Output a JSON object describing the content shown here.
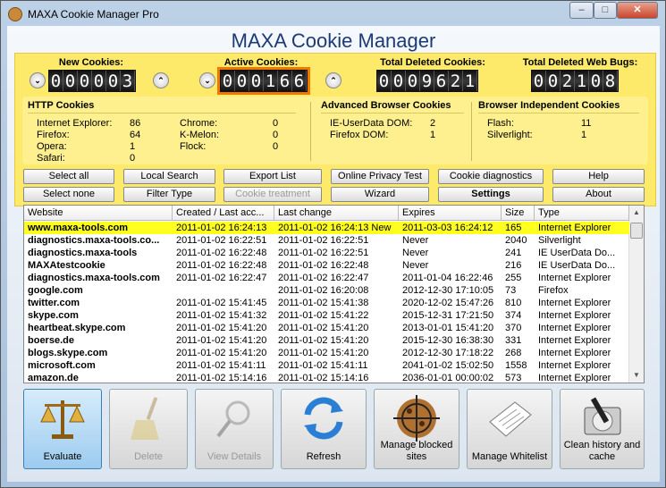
{
  "window": {
    "title": "MAXA Cookie Manager Pro",
    "minimize": "–",
    "maximize": "□",
    "close": "✕"
  },
  "brand": "MAXA Cookie Manager",
  "counters": [
    {
      "label": "New Cookies:",
      "digits": [
        "0",
        "0",
        "0",
        "0",
        "0",
        "3"
      ]
    },
    {
      "label": "Active Cookies:",
      "digits": [
        "0",
        "0",
        "0",
        "1",
        "6",
        "6"
      ]
    },
    {
      "label": "Total Deleted Cookies:",
      "digits": [
        "0",
        "0",
        "0",
        "9",
        "6",
        "2",
        "1"
      ]
    },
    {
      "label": "Total Deleted Web Bugs:",
      "digits": [
        "0",
        "0",
        "2",
        "1",
        "0",
        "8"
      ]
    }
  ],
  "arrows": {
    "down": "⌄",
    "up": "⌃"
  },
  "stats": {
    "http": {
      "title": "HTTP Cookies",
      "items": [
        [
          "Internet Explorer:",
          "86"
        ],
        [
          "Firefox:",
          "64"
        ],
        [
          "Opera:",
          "1"
        ],
        [
          "Safari:",
          "0"
        ],
        [
          "Chrome:",
          "0"
        ],
        [
          "K-Melon:",
          "0"
        ],
        [
          "Flock:",
          "0"
        ]
      ]
    },
    "advanced": {
      "title": "Advanced Browser Cookies",
      "items": [
        [
          "IE-UserData DOM:",
          "2"
        ],
        [
          "Firefox DOM:",
          "1"
        ]
      ]
    },
    "independent": {
      "title": "Browser Independent Cookies",
      "items": [
        [
          "Flash:",
          "11"
        ],
        [
          "Silverlight:",
          "1"
        ]
      ]
    }
  },
  "buttons": {
    "select_all": "Select all",
    "local_search": "Local Search",
    "export_list": "Export List",
    "privacy_test": "Online Privacy Test",
    "diagnostics": "Cookie diagnostics",
    "help": "Help",
    "select_none": "Select none",
    "filter_type": "Filter Type",
    "cookie_treatment": "Cookie treatment",
    "wizard": "Wizard",
    "settings": "Settings",
    "about": "About"
  },
  "table": {
    "columns": [
      "Website",
      "Created / Last acc...",
      "Last change",
      "Expires",
      "Size",
      "Type"
    ],
    "rows": [
      [
        "www.maxa-tools.com",
        "2011-01-02 16:24:13",
        "2011-01-02 16:24:13 New",
        "2011-03-03 16:24:12",
        "165",
        "Internet Explorer"
      ],
      [
        "diagnostics.maxa-tools.co...",
        "2011-01-02 16:22:51",
        "2011-01-02 16:22:51",
        "Never",
        "2040",
        "Silverlight"
      ],
      [
        "diagnostics.maxa-tools",
        "2011-01-02 16:22:48",
        "2011-01-02 16:22:51",
        "Never",
        "241",
        "IE UserData Do..."
      ],
      [
        "MAXAtestcookie",
        "2011-01-02 16:22:48",
        "2011-01-02 16:22:48",
        "Never",
        "216",
        "IE UserData Do..."
      ],
      [
        "diagnostics.maxa-tools.com",
        "2011-01-02 16:22:47",
        "2011-01-02 16:22:47",
        "2011-01-04 16:22:46",
        "255",
        "Internet Explorer"
      ],
      [
        "google.com",
        "",
        "2011-01-02 16:20:08",
        "2012-12-30 17:10:05",
        "73",
        "Firefox"
      ],
      [
        "twitter.com",
        "2011-01-02 15:41:45",
        "2011-01-02 15:41:38",
        "2020-12-02 15:47:26",
        "810",
        "Internet Explorer"
      ],
      [
        "skype.com",
        "2011-01-02 15:41:32",
        "2011-01-02 15:41:22",
        "2015-12-31 17:21:50",
        "374",
        "Internet Explorer"
      ],
      [
        "heartbeat.skype.com",
        "2011-01-02 15:41:20",
        "2011-01-02 15:41:20",
        "2013-01-01 15:41:20",
        "370",
        "Internet Explorer"
      ],
      [
        "boerse.de",
        "2011-01-02 15:41:20",
        "2011-01-02 15:41:20",
        "2015-12-30 16:38:30",
        "331",
        "Internet Explorer"
      ],
      [
        "blogs.skype.com",
        "2011-01-02 15:41:20",
        "2011-01-02 15:41:20",
        "2012-12-30 17:18:22",
        "268",
        "Internet Explorer"
      ],
      [
        "microsoft.com",
        "2011-01-02 15:41:11",
        "2011-01-02 15:41:11",
        "2041-01-02 15:02:50",
        "1558",
        "Internet Explorer"
      ],
      [
        "amazon.de",
        "2011-01-02 15:14:16",
        "2011-01-02 15:14:16",
        "2036-01-01 00:00:02",
        "573",
        "Internet Explorer"
      ]
    ],
    "scroll_up": "▲",
    "scroll_down": "▼"
  },
  "actions": [
    {
      "label": "Evaluate",
      "icon": "scales-icon"
    },
    {
      "label": "Delete",
      "icon": "broom-icon"
    },
    {
      "label": "View Details",
      "icon": "magnifier-icon"
    },
    {
      "label": "Refresh",
      "icon": "refresh-icon"
    },
    {
      "label": "Manage blocked sites",
      "icon": "crosshair-cookie-icon"
    },
    {
      "label": "Manage Whitelist",
      "icon": "document-icon"
    },
    {
      "label": "Clean history and cache",
      "icon": "harddisk-icon"
    }
  ]
}
